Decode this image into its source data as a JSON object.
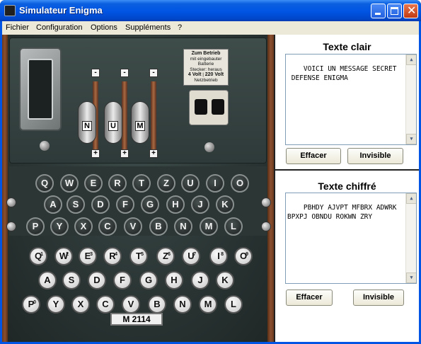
{
  "window": {
    "title": "Simulateur Enigma"
  },
  "menu": [
    "Fichier",
    "Configuration",
    "Options",
    "Suppléments",
    "?"
  ],
  "machine": {
    "tab_plate": [
      "Zum Betrieb",
      "mit eingebauter",
      "Batterie",
      "Stecker: heraus",
      "4 Volt",
      "220 Volt",
      "Netzbetrieb"
    ],
    "rotors": [
      {
        "minus": "-",
        "plus": "+",
        "letter": "N"
      },
      {
        "minus": "-",
        "plus": "+",
        "letter": "U"
      },
      {
        "minus": "-",
        "plus": "+",
        "letter": "M"
      }
    ],
    "lamp_rows": [
      [
        "Q",
        "W",
        "E",
        "R",
        "T",
        "Z",
        "U",
        "I",
        "O"
      ],
      [
        "A",
        "S",
        "D",
        "F",
        "G",
        "H",
        "J",
        "K"
      ],
      [
        "P",
        "Y",
        "X",
        "C",
        "V",
        "B",
        "N",
        "M",
        "L"
      ]
    ],
    "key_rows": [
      [
        {
          "l": "Q",
          "n": "1"
        },
        {
          "l": "W",
          "n": "2"
        },
        {
          "l": "E",
          "n": "3"
        },
        {
          "l": "R",
          "n": "4"
        },
        {
          "l": "T",
          "n": "5"
        },
        {
          "l": "Z",
          "n": "6"
        },
        {
          "l": "U",
          "n": "7"
        },
        {
          "l": "I",
          "n": "8"
        },
        {
          "l": "O",
          "n": "9"
        }
      ],
      [
        {
          "l": "A"
        },
        {
          "l": "S"
        },
        {
          "l": "D"
        },
        {
          "l": "F"
        },
        {
          "l": "G"
        },
        {
          "l": "H"
        },
        {
          "l": "J"
        },
        {
          "l": "K"
        }
      ],
      [
        {
          "l": "P",
          "n": "0"
        },
        {
          "l": "Y"
        },
        {
          "l": "X"
        },
        {
          "l": "C"
        },
        {
          "l": "V"
        },
        {
          "l": "B"
        },
        {
          "l": "N"
        },
        {
          "l": "M"
        },
        {
          "l": "L"
        }
      ]
    ],
    "serial": "M 2114"
  },
  "plain": {
    "title": "Texte clair",
    "text": "VOICI UN MESSAGE SECRET\n DEFENSE ENIGMA",
    "clear_label": "Effacer",
    "invisible_label": "Invisible"
  },
  "cipher": {
    "title": "Texte chiffré",
    "text": "PBHDY AJVPT MFBRX ADWRK\nBPXPJ OBNDU ROKWN ZRY",
    "clear_label": "Effacer",
    "invisible_label": "Invisible"
  },
  "colors": {
    "titlebar": "#0054e3",
    "face": "#ece9d8",
    "machine": "#2c3634"
  }
}
